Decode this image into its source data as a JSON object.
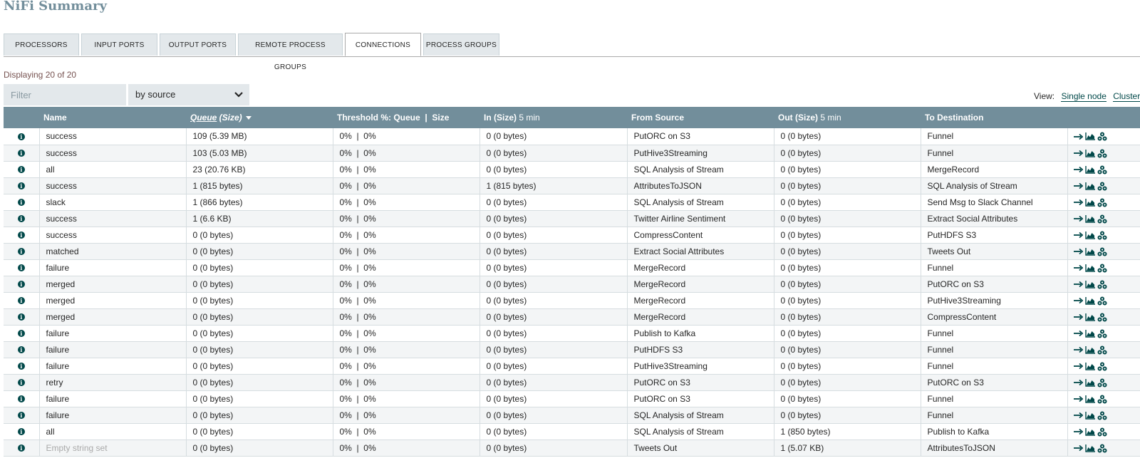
{
  "page_title": "NiFi Summary",
  "tabs": [
    {
      "label": "PROCESSORS"
    },
    {
      "label": "INPUT PORTS"
    },
    {
      "label": "OUTPUT PORTS"
    },
    {
      "label": "REMOTE PROCESS GROUPS"
    },
    {
      "label": "CONNECTIONS"
    },
    {
      "label": "PROCESS GROUPS"
    }
  ],
  "selected_tab": "CONNECTIONS",
  "displaying": "Displaying 20 of 20",
  "filter": {
    "placeholder": "Filter",
    "value": ""
  },
  "filter_by": {
    "selected": "by source"
  },
  "view": {
    "label": "View:",
    "single_node": "Single node",
    "cluster": "Cluster"
  },
  "columns": {
    "name": "Name",
    "queue_main": "Queue",
    "queue_rest": " (Size)",
    "threshold": "Threshold %: Queue  |  Size",
    "in_main": "In (Size)",
    "in_unit": "5 min",
    "from_source": "From Source",
    "out_main": "Out (Size)",
    "out_unit": "5 min",
    "to_destination": "To Destination"
  },
  "icons": {
    "info": "info-icon",
    "goto": "go-to-arrow-icon",
    "stats": "area-chart-icon",
    "cluster": "cluster-icon"
  },
  "colors": {
    "header": "#728e9b",
    "title": "#728e9b",
    "icon": "#004849",
    "displaying": "#775351"
  },
  "rows": [
    {
      "name": "success",
      "queue": "109 (5.39 MB)",
      "threshold": "0%  |  0%",
      "in": "0 (0 bytes)",
      "from": "PutORC on S3",
      "out": "0 (0 bytes)",
      "to": "Funnel"
    },
    {
      "name": "success",
      "queue": "103 (5.03 MB)",
      "threshold": "0%  |  0%",
      "in": "0 (0 bytes)",
      "from": "PutHive3Streaming",
      "out": "0 (0 bytes)",
      "to": "Funnel"
    },
    {
      "name": "all",
      "queue": "23 (20.76 KB)",
      "threshold": "0%  |  0%",
      "in": "0 (0 bytes)",
      "from": "SQL Analysis of Stream",
      "out": "0 (0 bytes)",
      "to": "MergeRecord"
    },
    {
      "name": "success",
      "queue": "1 (815 bytes)",
      "threshold": "0%  |  0%",
      "in": "1 (815 bytes)",
      "from": "AttributesToJSON",
      "out": "0 (0 bytes)",
      "to": "SQL Analysis of Stream"
    },
    {
      "name": "slack",
      "queue": "1 (866 bytes)",
      "threshold": "0%  |  0%",
      "in": "0 (0 bytes)",
      "from": "SQL Analysis of Stream",
      "out": "0 (0 bytes)",
      "to": "Send Msg to Slack Channel"
    },
    {
      "name": "success",
      "queue": "1 (6.6 KB)",
      "threshold": "0%  |  0%",
      "in": "0 (0 bytes)",
      "from": "Twitter Airline Sentiment",
      "out": "0 (0 bytes)",
      "to": "Extract Social Attributes"
    },
    {
      "name": "success",
      "queue": "0 (0 bytes)",
      "threshold": "0%  |  0%",
      "in": "0 (0 bytes)",
      "from": "CompressContent",
      "out": "0 (0 bytes)",
      "to": "PutHDFS S3"
    },
    {
      "name": "matched",
      "queue": "0 (0 bytes)",
      "threshold": "0%  |  0%",
      "in": "0 (0 bytes)",
      "from": "Extract Social Attributes",
      "out": "0 (0 bytes)",
      "to": "Tweets Out"
    },
    {
      "name": "failure",
      "queue": "0 (0 bytes)",
      "threshold": "0%  |  0%",
      "in": "0 (0 bytes)",
      "from": "MergeRecord",
      "out": "0 (0 bytes)",
      "to": "Funnel"
    },
    {
      "name": "merged",
      "queue": "0 (0 bytes)",
      "threshold": "0%  |  0%",
      "in": "0 (0 bytes)",
      "from": "MergeRecord",
      "out": "0 (0 bytes)",
      "to": "PutORC on S3"
    },
    {
      "name": "merged",
      "queue": "0 (0 bytes)",
      "threshold": "0%  |  0%",
      "in": "0 (0 bytes)",
      "from": "MergeRecord",
      "out": "0 (0 bytes)",
      "to": "PutHive3Streaming"
    },
    {
      "name": "merged",
      "queue": "0 (0 bytes)",
      "threshold": "0%  |  0%",
      "in": "0 (0 bytes)",
      "from": "MergeRecord",
      "out": "0 (0 bytes)",
      "to": "CompressContent"
    },
    {
      "name": "failure",
      "queue": "0 (0 bytes)",
      "threshold": "0%  |  0%",
      "in": "0 (0 bytes)",
      "from": "Publish to Kafka",
      "out": "0 (0 bytes)",
      "to": "Funnel"
    },
    {
      "name": "failure",
      "queue": "0 (0 bytes)",
      "threshold": "0%  |  0%",
      "in": "0 (0 bytes)",
      "from": "PutHDFS S3",
      "out": "0 (0 bytes)",
      "to": "Funnel"
    },
    {
      "name": "failure",
      "queue": "0 (0 bytes)",
      "threshold": "0%  |  0%",
      "in": "0 (0 bytes)",
      "from": "PutHive3Streaming",
      "out": "0 (0 bytes)",
      "to": "Funnel"
    },
    {
      "name": "retry",
      "queue": "0 (0 bytes)",
      "threshold": "0%  |  0%",
      "in": "0 (0 bytes)",
      "from": "PutORC on S3",
      "out": "0 (0 bytes)",
      "to": "PutORC on S3"
    },
    {
      "name": "failure",
      "queue": "0 (0 bytes)",
      "threshold": "0%  |  0%",
      "in": "0 (0 bytes)",
      "from": "PutORC on S3",
      "out": "0 (0 bytes)",
      "to": "Funnel"
    },
    {
      "name": "failure",
      "queue": "0 (0 bytes)",
      "threshold": "0%  |  0%",
      "in": "0 (0 bytes)",
      "from": "SQL Analysis of Stream",
      "out": "0 (0 bytes)",
      "to": "Funnel"
    },
    {
      "name": "all",
      "queue": "0 (0 bytes)",
      "threshold": "0%  |  0%",
      "in": "0 (0 bytes)",
      "from": "SQL Analysis of Stream",
      "out": "1 (850 bytes)",
      "to": "Publish to Kafka"
    },
    {
      "name": "Empty string set",
      "name_empty": true,
      "queue": "0 (0 bytes)",
      "threshold": "0%  |  0%",
      "in": "0 (0 bytes)",
      "from": "Tweets Out",
      "out": "1 (5.07 KB)",
      "to": "AttributesToJSON"
    }
  ]
}
